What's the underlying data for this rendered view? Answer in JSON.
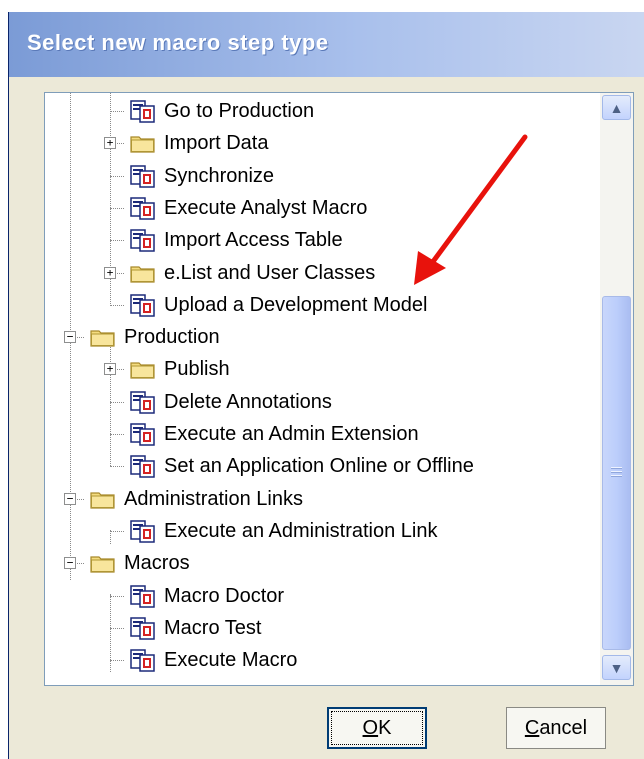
{
  "dialog": {
    "title": "Select new macro step type"
  },
  "tree": {
    "items": [
      {
        "label": "Go to Production",
        "type": "step"
      },
      {
        "label": "Import Data",
        "type": "folder",
        "state": "collapsed"
      },
      {
        "label": "Synchronize",
        "type": "step"
      },
      {
        "label": "Execute Analyst Macro",
        "type": "step"
      },
      {
        "label": "Import Access Table",
        "type": "step"
      },
      {
        "label": "e.List and User Classes",
        "type": "folder",
        "state": "collapsed"
      },
      {
        "label": "Upload a Development Model",
        "type": "step"
      },
      {
        "label": "Production",
        "type": "folder",
        "state": "expanded"
      },
      {
        "label": "Publish",
        "type": "folder",
        "state": "collapsed"
      },
      {
        "label": "Delete Annotations",
        "type": "step"
      },
      {
        "label": "Execute an Admin Extension",
        "type": "step"
      },
      {
        "label": "Set an Application Online or Offline",
        "type": "step"
      },
      {
        "label": "Administration Links",
        "type": "folder",
        "state": "expanded"
      },
      {
        "label": "Execute an Administration Link",
        "type": "step"
      },
      {
        "label": "Macros",
        "type": "folder",
        "state": "expanded"
      },
      {
        "label": "Macro Doctor",
        "type": "step"
      },
      {
        "label": "Macro Test",
        "type": "step"
      },
      {
        "label": "Execute Macro",
        "type": "step"
      }
    ],
    "expand_glyph": "+",
    "collapse_glyph": "−"
  },
  "buttons": {
    "ok_label": "OK",
    "cancel_label": "Cancel"
  },
  "icons": {
    "step": "macro-step-icon",
    "folder": "folder-icon",
    "annotation": "red-arrow-icon"
  },
  "colors": {
    "title_bar": "#7b9bd6",
    "arrow": "#e8120c",
    "folder": "#f4dc80"
  }
}
